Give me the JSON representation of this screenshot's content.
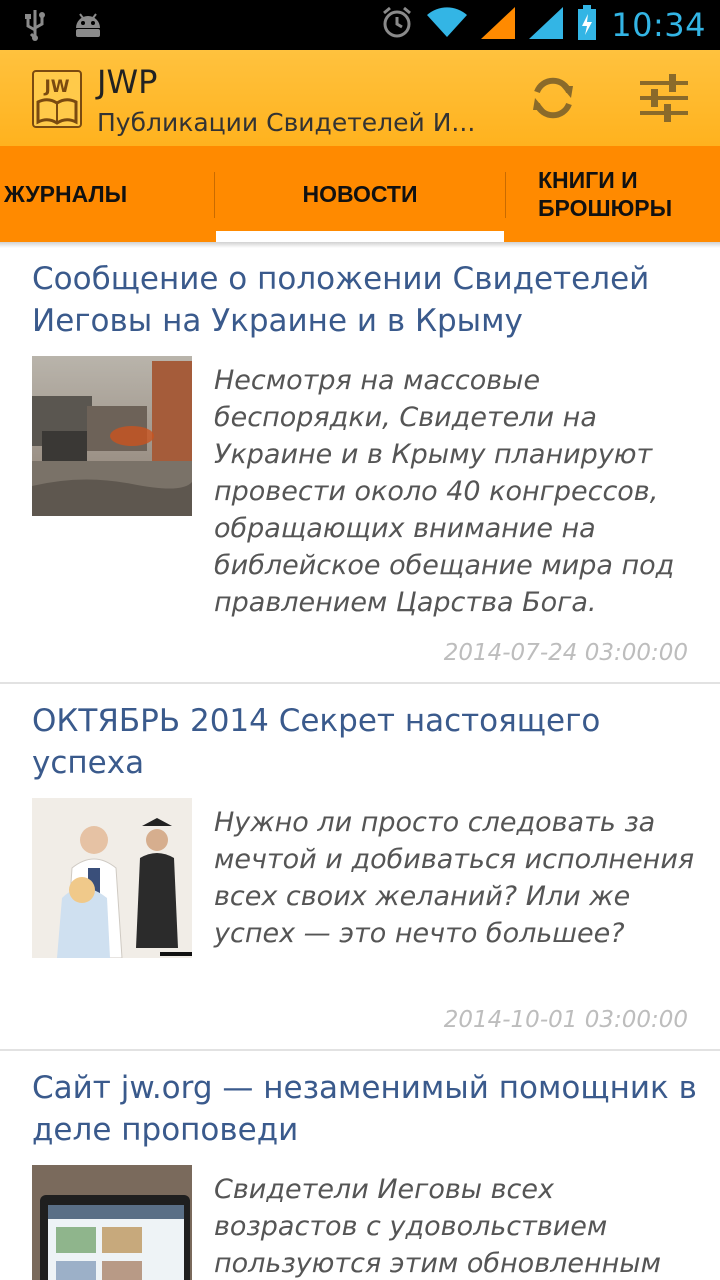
{
  "status_bar": {
    "time": "10:34",
    "icons": [
      "usb-icon",
      "android-icon",
      "alarm-icon",
      "wifi-icon",
      "signal-icon",
      "signal-icon",
      "battery-icon"
    ]
  },
  "action_bar": {
    "title": "JWP",
    "subtitle": "Публикации Свидетелей И...",
    "logo_text": "JW",
    "refresh_icon": "refresh-icon",
    "settings_icon": "settings-sliders-icon"
  },
  "tabs": [
    {
      "label": "ЖУРНАЛЫ"
    },
    {
      "label": "НОВОСТИ",
      "selected": true
    },
    {
      "label_line1": "КНИГИ И",
      "label_line2": "БРОШЮРЫ"
    }
  ],
  "articles": [
    {
      "title": "Сообщение о положении Свидетелей Иеговы на Украине и в Крыму",
      "description": "Несмотря на массовые беспорядки, Свидетели на Украине и в Крыму планируют провести около 40 конгрессов, обращающих внимание на библейское обещание мира под правлением Царства Бога.",
      "date": "2014-07-24 03:00:00"
    },
    {
      "title": "ОКТЯБРЬ 2014 Секрет настоящего успеха",
      "description": "Нужно ли просто следовать за мечтой и добиваться исполнения всех своих желаний? Или же успех — это нечто большее?",
      "date": "2014-10-01 03:00:00"
    },
    {
      "title": "Сайт jw.org — незаменимый помощник в деле проповеди",
      "description": "Свидетели Иеговы всех возрастов с удовольствием пользуются этим обновленным",
      "date": ""
    }
  ],
  "colors": {
    "action_bar": "#ffb21e",
    "tabs": "#ff8a00",
    "title_link": "#3a5a8c",
    "time": "#33b5e5"
  }
}
